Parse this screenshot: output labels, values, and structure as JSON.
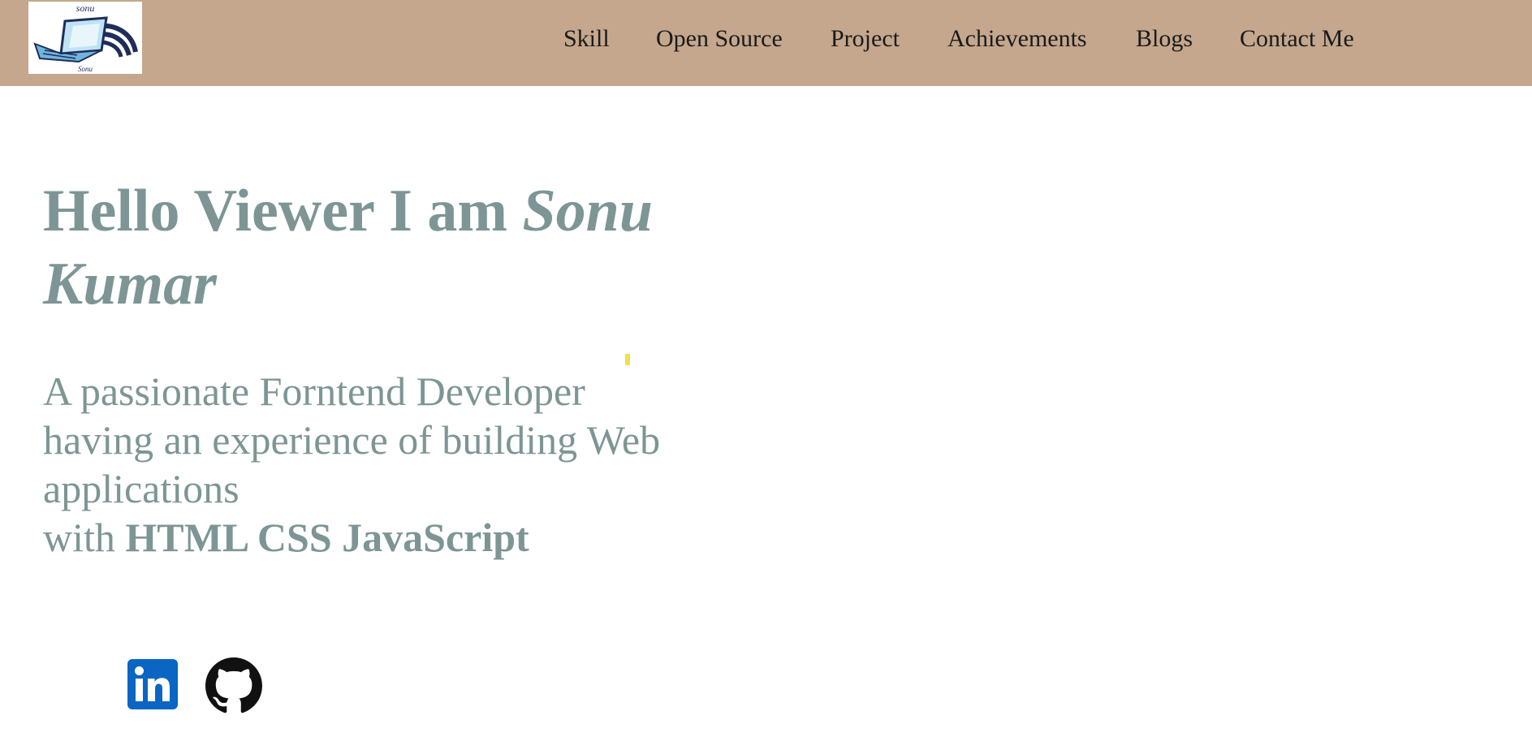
{
  "logo": {
    "top_text": "sonu",
    "bottom_text": "Sonu"
  },
  "nav": {
    "items": [
      {
        "label": "Skill"
      },
      {
        "label": "Open Source"
      },
      {
        "label": "Project"
      },
      {
        "label": "Achievements"
      },
      {
        "label": "Blogs"
      },
      {
        "label": "Contact Me"
      }
    ]
  },
  "hero": {
    "greeting": "Hello Viewer I am ",
    "name_line1": "Sonu",
    "name_line2": "Kumar"
  },
  "tagline": {
    "line1": "A passionate Forntend Developer",
    "line2": "having an experience of building Web",
    "line3": "applications",
    "with_prefix": "with ",
    "skills": "HTML CSS JavaScript"
  },
  "social": {
    "linkedin_icon": "linkedin-icon",
    "github_icon": "github-icon"
  },
  "colors": {
    "navbar": "#c4a78c",
    "hero_text": "#7d9595",
    "linkedin_blue": "#0a66c2"
  }
}
